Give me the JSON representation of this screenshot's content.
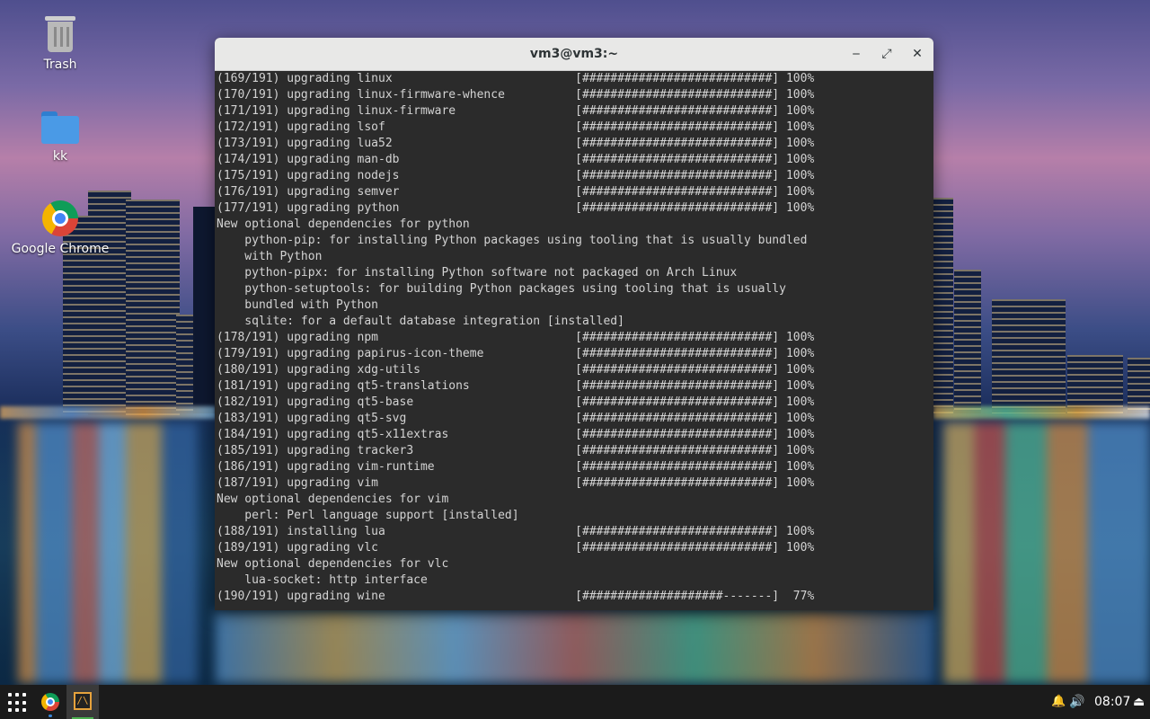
{
  "colors": {
    "terminal_bg": "#2b2b2b",
    "terminal_fg": "#d3d3d3",
    "titlebar_bg": "#e8e8e7",
    "taskbar_bg": "#1b1b1b",
    "chrome_indicator": "#3a86d8",
    "terminal_indicator": "#4caf50"
  },
  "desktop": {
    "icons": [
      {
        "label": "Trash",
        "icon": "trash-icon"
      },
      {
        "label": "kk",
        "icon": "folder-icon"
      },
      {
        "label": "Google Chrome",
        "icon": "chrome-icon"
      }
    ]
  },
  "window": {
    "title": "vm3@vm3:~",
    "minimize": "‒",
    "maximize": "⤢",
    "close": "✕"
  },
  "terminal": {
    "lines": [
      "(169/191) upgrading linux                          [###########################] 100%",
      "(170/191) upgrading linux-firmware-whence          [###########################] 100%",
      "(171/191) upgrading linux-firmware                 [###########################] 100%",
      "(172/191) upgrading lsof                           [###########################] 100%",
      "(173/191) upgrading lua52                          [###########################] 100%",
      "(174/191) upgrading man-db                         [###########################] 100%",
      "(175/191) upgrading nodejs                         [###########################] 100%",
      "(176/191) upgrading semver                         [###########################] 100%",
      "(177/191) upgrading python                         [###########################] 100%",
      "New optional dependencies for python",
      "    python-pip: for installing Python packages using tooling that is usually bundled",
      "    with Python",
      "    python-pipx: for installing Python software not packaged on Arch Linux",
      "    python-setuptools: for building Python packages using tooling that is usually",
      "    bundled with Python",
      "    sqlite: for a default database integration [installed]",
      "(178/191) upgrading npm                            [###########################] 100%",
      "(179/191) upgrading papirus-icon-theme             [###########################] 100%",
      "(180/191) upgrading xdg-utils                      [###########################] 100%",
      "(181/191) upgrading qt5-translations               [###########################] 100%",
      "(182/191) upgrading qt5-base                       [###########################] 100%",
      "(183/191) upgrading qt5-svg                        [###########################] 100%",
      "(184/191) upgrading qt5-x11extras                  [###########################] 100%",
      "(185/191) upgrading tracker3                       [###########################] 100%",
      "(186/191) upgrading vim-runtime                    [###########################] 100%",
      "(187/191) upgrading vim                            [###########################] 100%",
      "New optional dependencies for vim",
      "    perl: Perl language support [installed]",
      "(188/191) installing lua                           [###########################] 100%",
      "(189/191) upgrading vlc                            [###########################] 100%",
      "New optional dependencies for vlc",
      "    lua-socket: http interface",
      "(190/191) upgrading wine                           [####################-------]  77%"
    ]
  },
  "taskbar": {
    "apps_icon": "app-grid-icon",
    "items": [
      {
        "icon": "chrome-icon",
        "active": false
      },
      {
        "icon": "terminal-icon",
        "glyph": "/\\",
        "active": true
      }
    ],
    "notification_icon": "🔔",
    "volume_icon": "🔊",
    "clock": "08:07",
    "logout_icon": "⏏"
  }
}
